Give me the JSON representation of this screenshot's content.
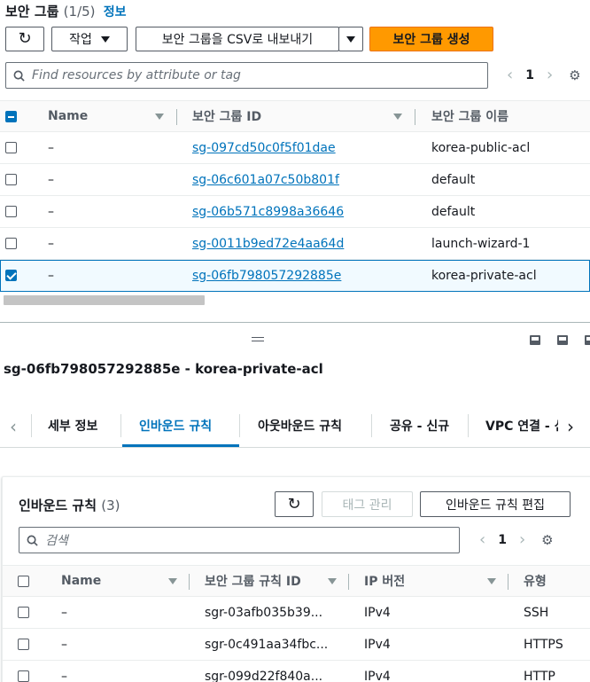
{
  "header": {
    "title": "보안 그룹",
    "count": "(1/5)",
    "info_link": "정보"
  },
  "toolbar": {
    "actions_label": "작업",
    "export_label": "보안 그룹을 CSV로 내보내기",
    "create_label": "보안 그룹 생성"
  },
  "search": {
    "placeholder": "Find resources by attribute or tag"
  },
  "pager": {
    "page": "1"
  },
  "table": {
    "columns": [
      "Name",
      "보안 그룹 ID",
      "보안 그룹 이름"
    ],
    "rows": [
      {
        "name": "–",
        "id": "sg-097cd50c0f5f01dae",
        "group_name": "korea-public-acl",
        "selected": false
      },
      {
        "name": "–",
        "id": "sg-06c601a07c50b801f",
        "group_name": "default",
        "selected": false
      },
      {
        "name": "–",
        "id": "sg-06b571c8998a36646",
        "group_name": "default",
        "selected": false
      },
      {
        "name": "–",
        "id": "sg-0011b9ed72e4aa64d",
        "group_name": "launch-wizard-1",
        "selected": false
      },
      {
        "name": "–",
        "id": "sg-06fb798057292885e",
        "group_name": "korea-private-acl",
        "selected": true
      }
    ]
  },
  "detail": {
    "title": "sg-06fb798057292885e - korea-private-acl",
    "tabs": [
      {
        "label": "세부 정보",
        "active": false
      },
      {
        "label": "인바운드 규칙",
        "active": true
      },
      {
        "label": "아웃바운드 규칙",
        "active": false
      },
      {
        "label": "공유 - 신규",
        "active": false
      },
      {
        "label": "VPC 연결 - 신",
        "active": false
      }
    ]
  },
  "inbound": {
    "title": "인바운드 규칙",
    "count": "(3)",
    "manage_tags_label": "태그 관리",
    "edit_label": "인바운드 규칙 편집",
    "search_placeholder": "검색",
    "page": "1",
    "columns": [
      "Name",
      "보안 그룹 규칙 ID",
      "IP 버전",
      "유형"
    ],
    "rows": [
      {
        "name": "–",
        "rule_id": "sgr-03afb035b39...",
        "ip_version": "IPv4",
        "type": "SSH"
      },
      {
        "name": "–",
        "rule_id": "sgr-0c491aa34fbc...",
        "ip_version": "IPv4",
        "type": "HTTPS"
      },
      {
        "name": "–",
        "rule_id": "sgr-099d22f840a...",
        "ip_version": "IPv4",
        "type": "HTTP"
      }
    ]
  },
  "colors": {
    "primary": "#ff9900",
    "link": "#0073bb",
    "selected_row_bg": "#f1faff"
  },
  "icons": [
    "refresh-icon",
    "caret-down-icon",
    "search-icon",
    "chevron-left-icon",
    "chevron-right-icon",
    "gear-icon",
    "drag-handle-icon",
    "panel-bottom-icon",
    "panel-side-icon"
  ]
}
